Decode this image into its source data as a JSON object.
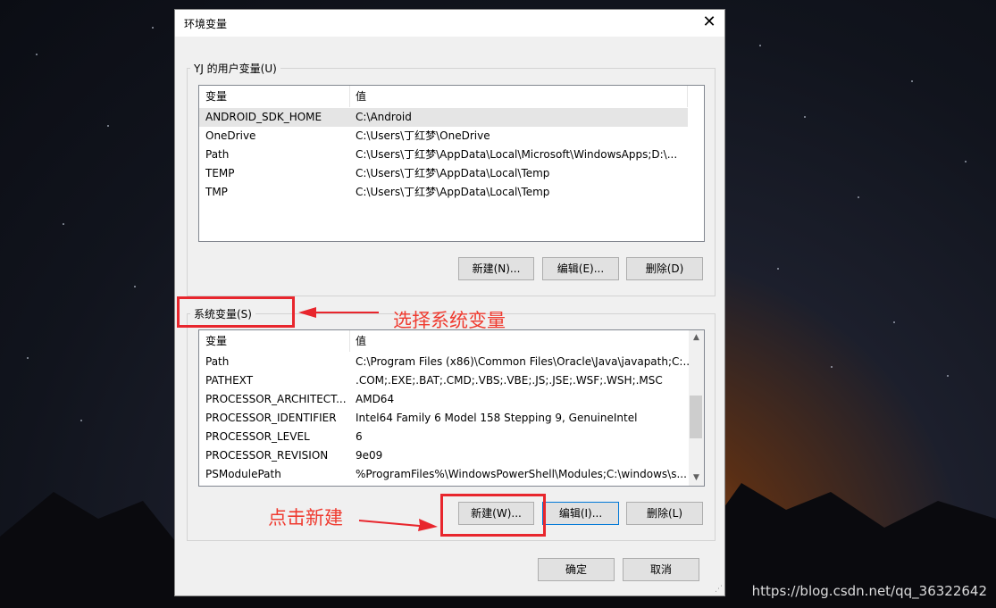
{
  "window": {
    "title": "环境变量",
    "close_icon": "close-icon"
  },
  "user_group": {
    "label": "YJ 的用户变量(U)",
    "columns": [
      "变量",
      "值"
    ],
    "rows": [
      {
        "name": "ANDROID_SDK_HOME",
        "value": "C:\\Android"
      },
      {
        "name": "OneDrive",
        "value": "C:\\Users\\丁红梦\\OneDrive"
      },
      {
        "name": "Path",
        "value": "C:\\Users\\丁红梦\\AppData\\Local\\Microsoft\\WindowsApps;D:\\..."
      },
      {
        "name": "TEMP",
        "value": "C:\\Users\\丁红梦\\AppData\\Local\\Temp"
      },
      {
        "name": "TMP",
        "value": "C:\\Users\\丁红梦\\AppData\\Local\\Temp"
      }
    ],
    "buttons": {
      "new": "新建(N)...",
      "edit": "编辑(E)...",
      "delete": "删除(D)"
    }
  },
  "system_group": {
    "label": "系统变量(S)",
    "columns": [
      "变量",
      "值"
    ],
    "rows": [
      {
        "name": "Path",
        "value": "C:\\Program Files (x86)\\Common Files\\Oracle\\Java\\javapath;C:..."
      },
      {
        "name": "PATHEXT",
        "value": ".COM;.EXE;.BAT;.CMD;.VBS;.VBE;.JS;.JSE;.WSF;.WSH;.MSC"
      },
      {
        "name": "PROCESSOR_ARCHITECT...",
        "value": "AMD64"
      },
      {
        "name": "PROCESSOR_IDENTIFIER",
        "value": "Intel64 Family 6 Model 158 Stepping 9, GenuineIntel"
      },
      {
        "name": "PROCESSOR_LEVEL",
        "value": "6"
      },
      {
        "name": "PROCESSOR_REVISION",
        "value": "9e09"
      },
      {
        "name": "PSModulePath",
        "value": "%ProgramFiles%\\WindowsPowerShell\\Modules;C:\\windows\\s..."
      }
    ],
    "buttons": {
      "new": "新建(W)...",
      "edit": "编辑(I)...",
      "delete": "删除(L)"
    }
  },
  "dialog_buttons": {
    "ok": "确定",
    "cancel": "取消"
  },
  "annotations": {
    "select_system": "选择系统变量",
    "click_new": "点击新建"
  },
  "watermark": "https://blog.csdn.net/qq_36322642",
  "colors": {
    "highlight": "#e8262d",
    "annotation_text": "#ef3b30",
    "focus_border": "#0078d7"
  }
}
